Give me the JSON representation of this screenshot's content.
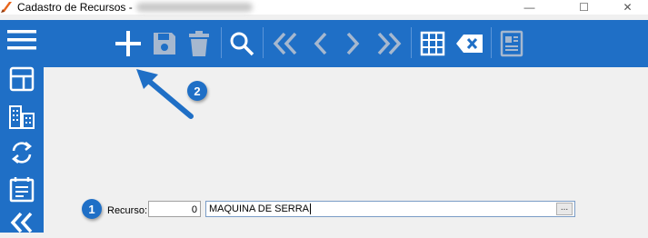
{
  "window": {
    "title": "Cadastro de Recursos",
    "title_dash": "-",
    "min_glyph": "—",
    "max_glyph": "☐",
    "close_glyph": "✕"
  },
  "colors": {
    "toolbar_blue": "#1f6fc6",
    "callout_blue": "#1f6fc6",
    "disabled_icon": "#a6b8cf"
  },
  "sidebar": {
    "items": [
      {
        "icon": "hamburger-menu-icon"
      },
      {
        "icon": "layout-panel-icon"
      },
      {
        "icon": "buildings-icon"
      },
      {
        "icon": "refresh-icon"
      },
      {
        "icon": "list-document-icon"
      },
      {
        "icon": "double-chevron-left-icon"
      }
    ]
  },
  "toolbar": {
    "items": [
      {
        "icon": "plus-icon",
        "state": "enabled"
      },
      {
        "icon": "save-icon",
        "state": "disabled"
      },
      {
        "icon": "trash-icon",
        "state": "disabled"
      },
      {
        "icon": "search-icon",
        "state": "enabled"
      },
      {
        "icon": "first-record-icon",
        "state": "disabled"
      },
      {
        "icon": "previous-record-icon",
        "state": "disabled"
      },
      {
        "icon": "next-record-icon",
        "state": "disabled"
      },
      {
        "icon": "last-record-icon",
        "state": "disabled"
      },
      {
        "icon": "grid-icon",
        "state": "enabled"
      },
      {
        "icon": "clear-icon",
        "state": "enabled"
      },
      {
        "icon": "report-icon",
        "state": "disabled"
      }
    ]
  },
  "callouts": {
    "one": "1",
    "two": "2"
  },
  "form": {
    "recurso_label": "Recurso:",
    "code_value": "0",
    "description_value": "MAQUINA DE SERRA",
    "lookup_button": "..."
  }
}
